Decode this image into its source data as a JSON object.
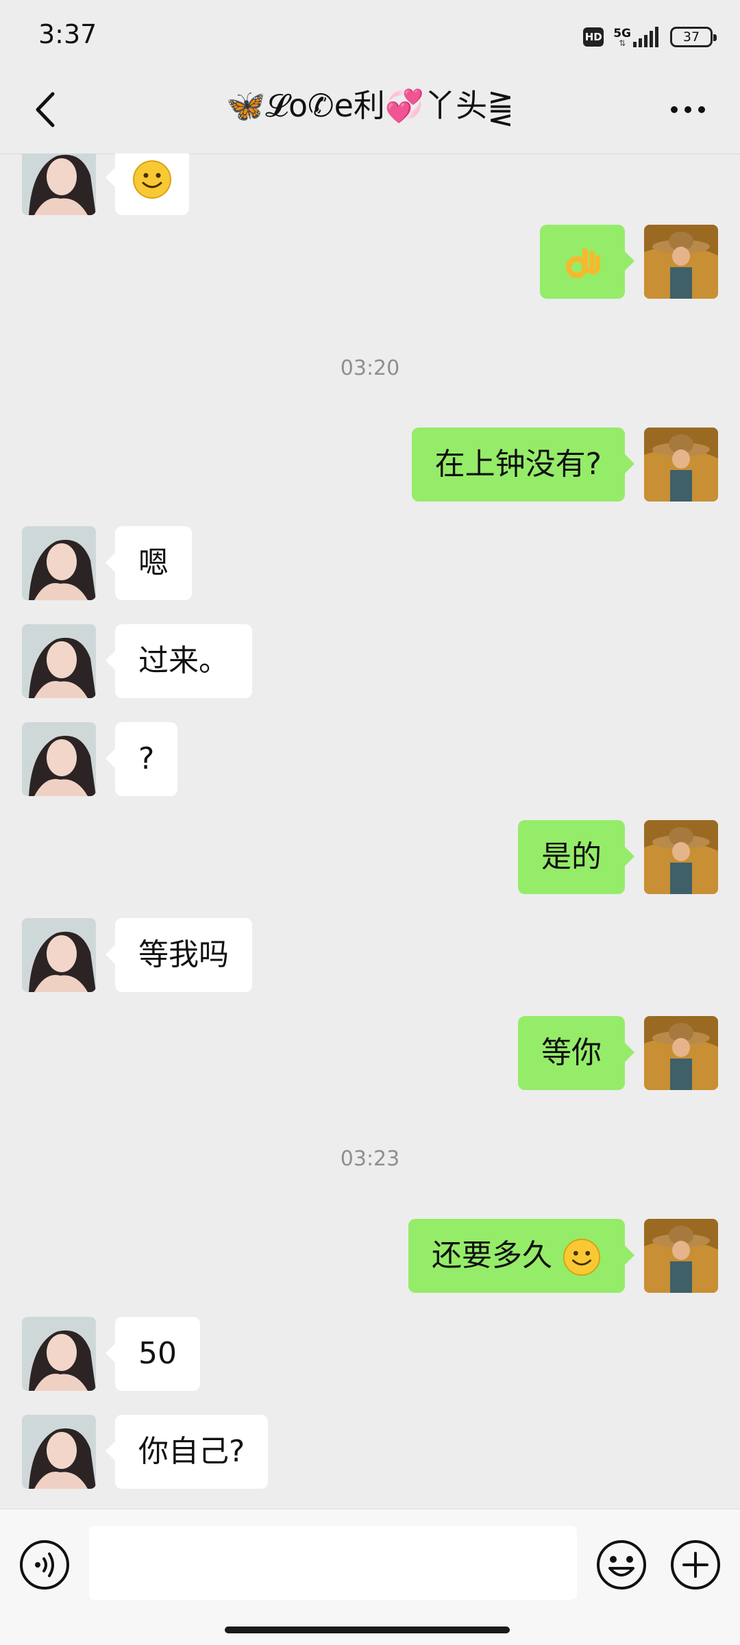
{
  "status_bar": {
    "time": "3:37",
    "hd_label": "HD",
    "network": "5G",
    "battery": "37"
  },
  "header": {
    "title": "🦋𝓛օ✆e利💞丫头⪌"
  },
  "messages": [
    {
      "side": "in",
      "type": "emoji",
      "emoji": "smile-emoji"
    },
    {
      "side": "out",
      "type": "emoji",
      "emoji": "ok-hand-emoji"
    },
    {
      "type": "time",
      "text": "03:20"
    },
    {
      "side": "out",
      "type": "text",
      "text": "在上钟没有?"
    },
    {
      "side": "in",
      "type": "text",
      "text": "嗯"
    },
    {
      "side": "in",
      "type": "text",
      "text": "过来。"
    },
    {
      "side": "in",
      "type": "text",
      "text": "?"
    },
    {
      "side": "out",
      "type": "text",
      "text": "是的"
    },
    {
      "side": "in",
      "type": "text",
      "text": "等我吗"
    },
    {
      "side": "out",
      "type": "text",
      "text": "等你"
    },
    {
      "type": "time",
      "text": "03:23"
    },
    {
      "side": "out",
      "type": "text",
      "text": "还要多久",
      "emoji": "smile-emoji"
    },
    {
      "side": "in",
      "type": "text",
      "text": "50"
    },
    {
      "side": "in",
      "type": "text",
      "text": "你自己?"
    }
  ],
  "input": {
    "value": "",
    "placeholder": ""
  },
  "colors": {
    "background": "#ededed",
    "incoming_bubble": "#ffffff",
    "outgoing_bubble": "#95ec69",
    "timestamp": "#8f8f8f"
  }
}
